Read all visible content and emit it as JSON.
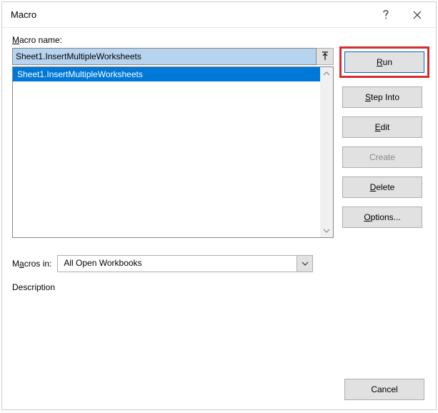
{
  "title": "Macro",
  "labels": {
    "macro_name": "Macro name:",
    "macros_in": "Macros in:",
    "description": "Description"
  },
  "name_input": {
    "value": "Sheet1.InsertMultipleWorksheets"
  },
  "list": {
    "items": [
      "Sheet1.InsertMultipleWorksheets"
    ]
  },
  "macros_in": {
    "selected": "All Open Workbooks"
  },
  "buttons": {
    "run_pre": "",
    "run_u": "R",
    "run_post": "un",
    "step_pre": "",
    "step_u": "S",
    "step_post": "tep Into",
    "edit_pre": "",
    "edit_u": "E",
    "edit_post": "dit",
    "create": "Create",
    "delete_pre": "",
    "delete_u": "D",
    "delete_post": "elete",
    "options_pre": "",
    "options_u": "O",
    "options_post": "ptions...",
    "cancel": "Cancel"
  }
}
